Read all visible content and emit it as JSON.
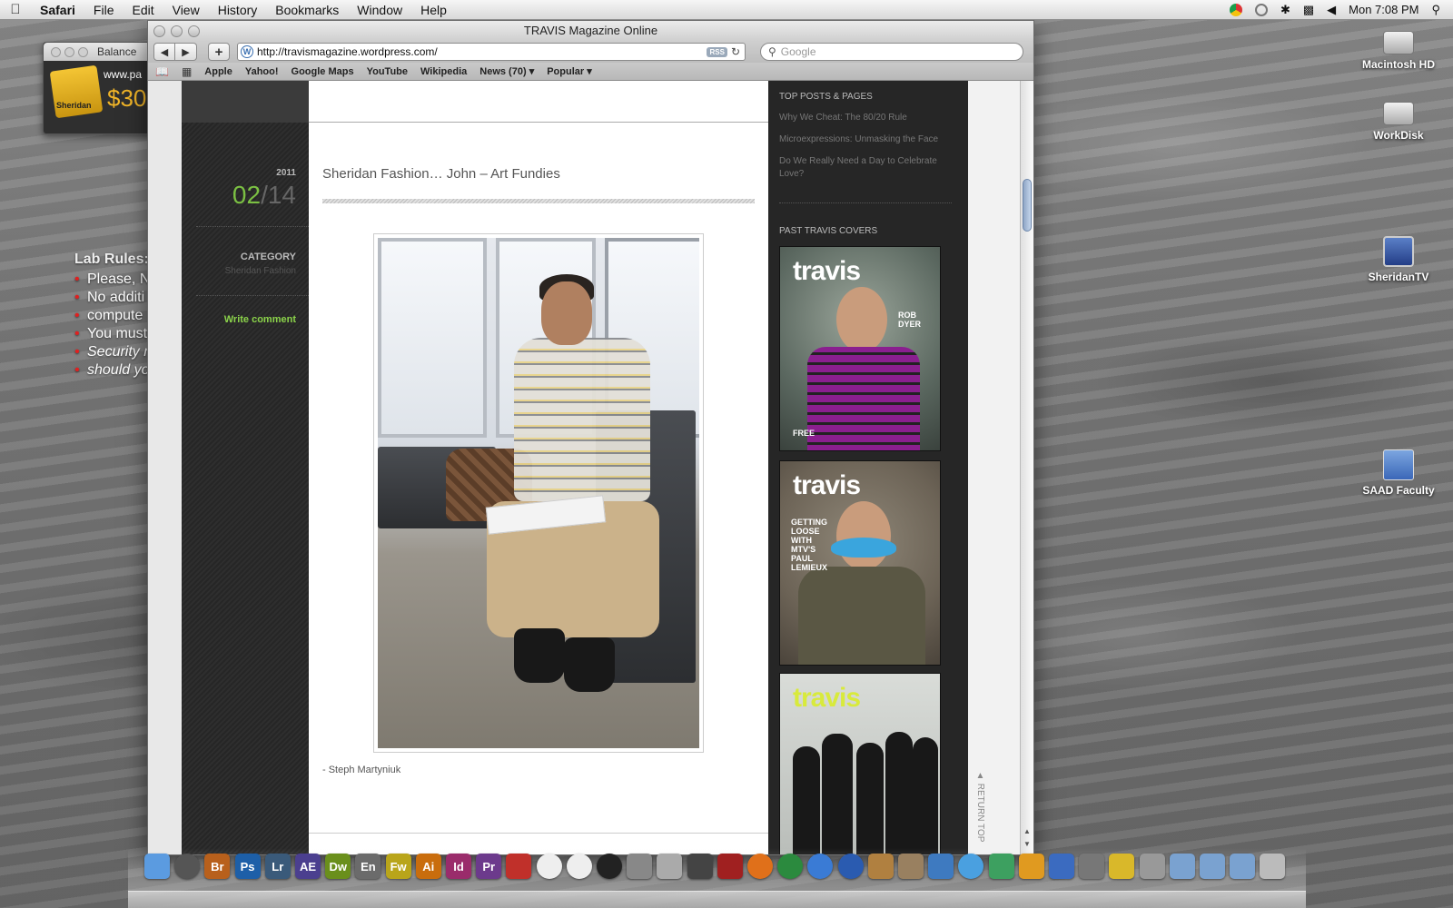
{
  "menubar": {
    "app": "Safari",
    "items": [
      "File",
      "Edit",
      "View",
      "History",
      "Bookmarks",
      "Window",
      "Help"
    ],
    "clock": "Mon 7:08 PM"
  },
  "widget": {
    "title": "Balance",
    "url": "www.pa",
    "amount": "$30",
    "logo_text": "Sheridan"
  },
  "lab_rules": {
    "title": "Lab Rules:",
    "lines": [
      "Please, N",
      "No additi",
      "compute",
      "You must",
      "Security m",
      "should yo"
    ]
  },
  "desktop_icons": [
    "Macintosh HD",
    "WorkDisk",
    "SheridanTV",
    "SAAD Faculty"
  ],
  "browser": {
    "window_title": "TRAVIS Magazine Online",
    "url": "http://travismagazine.wordpress.com/",
    "rss": "RSS",
    "search_placeholder": "Google",
    "bookmarks": [
      "Apple",
      "Yahoo!",
      "Google Maps",
      "YouTube",
      "Wikipedia",
      "News (70)",
      "Popular"
    ]
  },
  "post": {
    "year": "2011",
    "month": "02",
    "day": "/14",
    "category_label": "CATEGORY",
    "category": "Sheridan Fashion",
    "write_comment": "Write comment",
    "title": "Sheridan Fashion… John – Art Fundies",
    "credit": "- Steph Martyniuk"
  },
  "sidebar": {
    "top_posts_heading": "TOP POSTS & PAGES",
    "top_posts": [
      "Why We Cheat: The 80/20 Rule",
      "Microexpressions: Unmasking the Face",
      "Do We Really Need a Day to Celebrate Love?"
    ],
    "covers_heading": "PAST TRAVIS COVERS",
    "cover_logo": "travis",
    "cover1_name": "ROB DYER",
    "cover1_free": "FREE",
    "cover2_text": "GETTING LOOSE WITH MTV'S PAUL LEMIEUX",
    "return_top": "RETURN TOP"
  },
  "dock": [
    "Finder",
    "Dashboard",
    "Br",
    "Ps",
    "Lr",
    "AE",
    "Dw",
    "En",
    "Fw",
    "Ai",
    "Id",
    "Pr",
    "Acrobat",
    "Globe",
    "Globe",
    "DVD Player",
    "Time Machine",
    "Preview",
    "Bridge",
    "Flash",
    "Firefox",
    "Chrome",
    "Safari",
    "Network",
    "Script",
    "Photos",
    "Mail",
    "iTunes",
    "Widgets",
    "Pages",
    "Word",
    "Prefs",
    "Sheridan",
    "Calendar",
    "Applications",
    "Documents",
    "Downloads",
    "Trash"
  ]
}
